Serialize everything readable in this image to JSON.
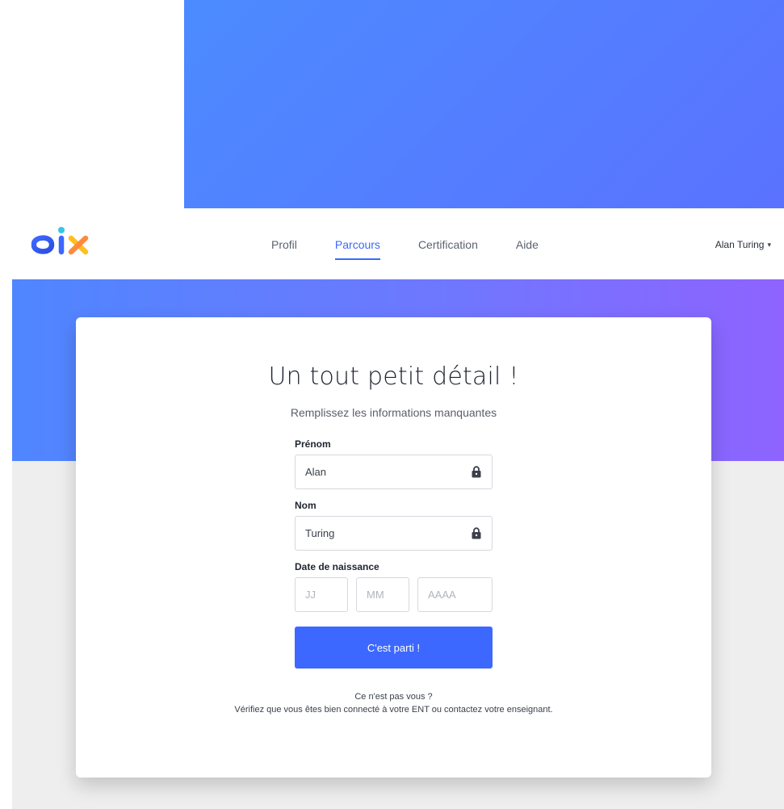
{
  "nav": {
    "logo_text": "pix",
    "links": [
      {
        "label": "Profil",
        "active": false
      },
      {
        "label": "Parcours",
        "active": true
      },
      {
        "label": "Certification",
        "active": false
      },
      {
        "label": "Aide",
        "active": false
      }
    ],
    "user_name": "Alan Turing",
    "user_caret_icon": "caret-down-icon"
  },
  "card": {
    "title": "Un tout petit détail !",
    "subtitle": "Remplissez les informations manquantes"
  },
  "form": {
    "first_name": {
      "label": "Prénom",
      "value": "Alan",
      "icon": "lock-icon"
    },
    "last_name": {
      "label": "Nom",
      "value": "Turing",
      "icon": "lock-icon"
    },
    "birthdate": {
      "label": "Date de naissance",
      "day_placeholder": "JJ",
      "month_placeholder": "MM",
      "year_placeholder": "AAAA"
    },
    "submit_label": "C'est parti !"
  },
  "help": {
    "question": "Ce n'est pas vous ?",
    "instruction": "Vérifiez que vous êtes bien connecté à votre ENT ou contactez votre enseignant."
  },
  "colors": {
    "accent": "#3d68ff",
    "gradient_start": "#4f86ff",
    "gradient_end": "#8e63ff",
    "page_background": "#eeeeee"
  }
}
